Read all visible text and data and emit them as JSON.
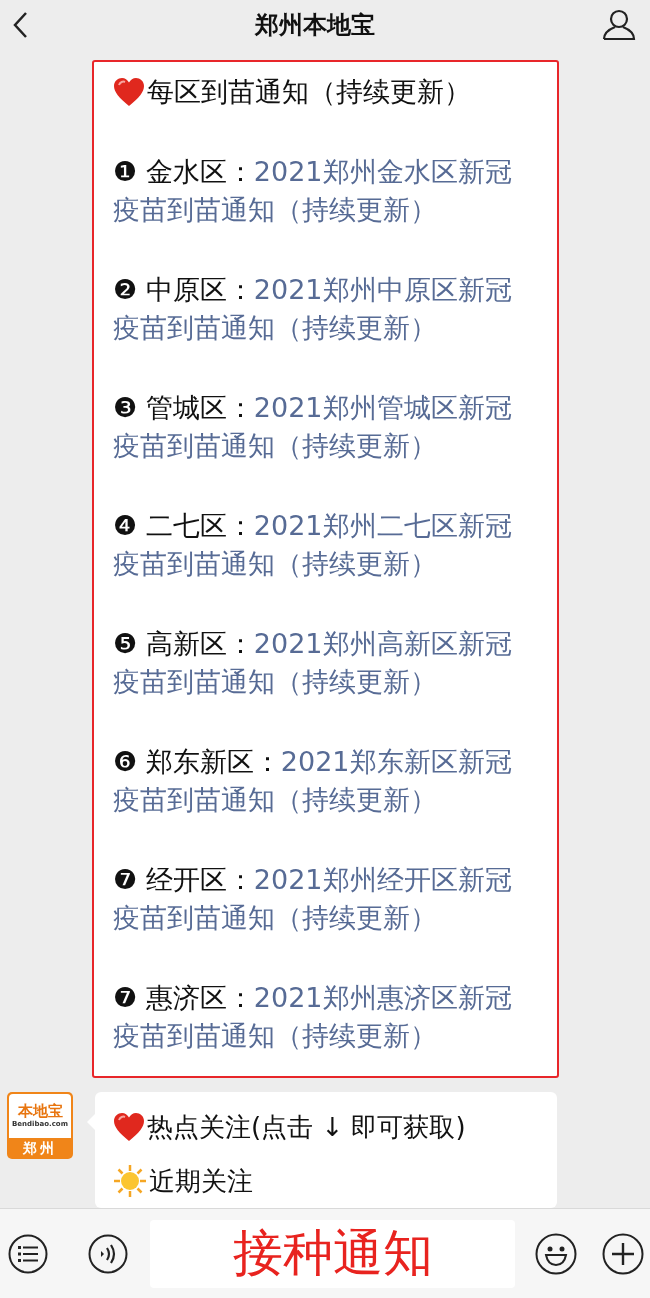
{
  "nav": {
    "title": "郑州本地宝"
  },
  "notice_card": {
    "heading": "每区到苗通知（持续更新）",
    "items": [
      {
        "number": "❶",
        "district": "金水区：",
        "link": "2021郑州金水区新冠疫苗到苗通知（持续更新）"
      },
      {
        "number": "❷",
        "district": "中原区：",
        "link": "2021郑州中原区新冠疫苗到苗通知（持续更新）"
      },
      {
        "number": "❸",
        "district": "管城区：",
        "link": "2021郑州管城区新冠疫苗到苗通知（持续更新）"
      },
      {
        "number": "❹",
        "district": "二七区：",
        "link": "2021郑州二七区新冠疫苗到苗通知（持续更新）"
      },
      {
        "number": "❺",
        "district": "高新区：",
        "link": "2021郑州高新区新冠疫苗到苗通知（持续更新）"
      },
      {
        "number": "❻",
        "district": "郑东新区：",
        "link": "2021郑东新区新冠疫苗到苗通知（持续更新）"
      },
      {
        "number": "❼",
        "district": "经开区：",
        "link": "2021郑州经开区新冠疫苗到苗通知（持续更新）"
      },
      {
        "number": "❼",
        "district": "惠济区：",
        "link": "2021郑州惠济区新冠疫苗到苗通知（持续更新）"
      }
    ]
  },
  "message": {
    "avatar": {
      "brand": "本地宝",
      "domain": "Bendibao.com",
      "city": "郑州"
    },
    "lines": [
      {
        "kind": "heart",
        "text": "热点关注(点击 ↓ 即可获取)"
      },
      {
        "kind": "sun",
        "text": "近期关注"
      }
    ]
  },
  "input_bar": {
    "value": "接种通知"
  }
}
